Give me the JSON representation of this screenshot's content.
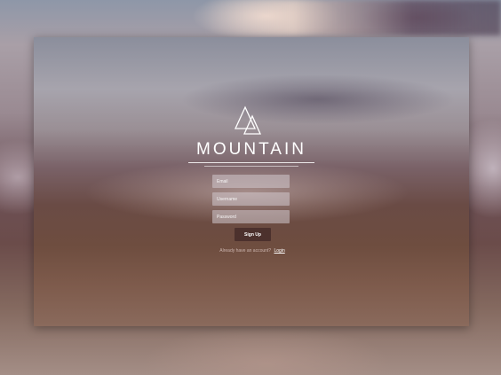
{
  "brand": {
    "name": "MOUNTAIN",
    "logo_icon": "double-triangle-icon"
  },
  "form": {
    "email_placeholder": "Email",
    "username_placeholder": "Username",
    "password_placeholder": "Password",
    "signup_label": "Sign Up"
  },
  "footer": {
    "prompt": "Already have an account?",
    "login_label": "Login"
  },
  "colors": {
    "text": "#ffffff",
    "button": "#46302c",
    "field": "#d2c8cd"
  }
}
